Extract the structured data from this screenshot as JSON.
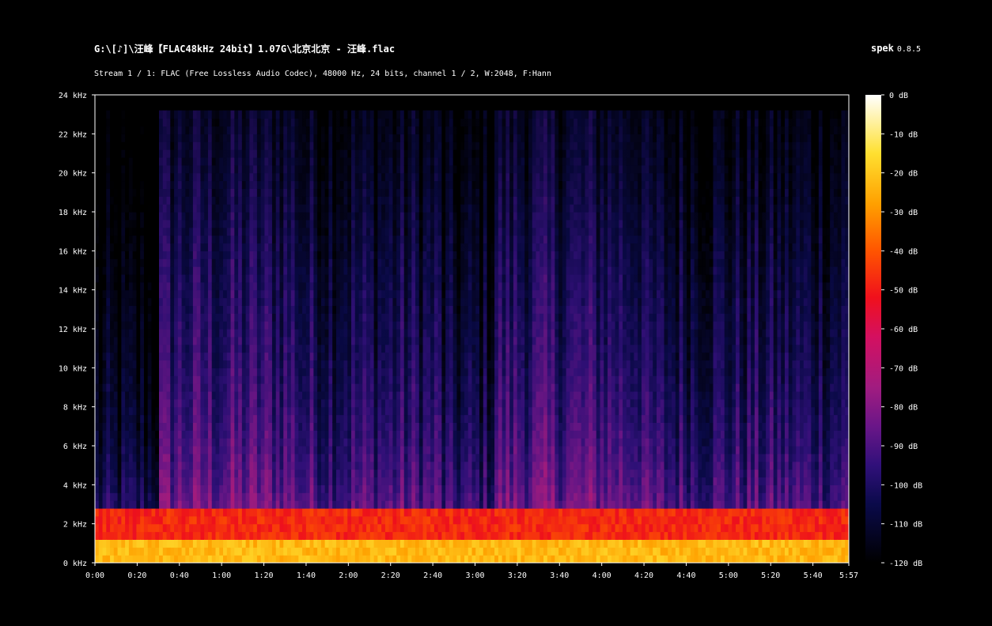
{
  "header": {
    "file_path": "G:\\[♪]\\汪峰【FLAC48kHz 24bit】1.07G\\北京北京 - 汪峰.flac",
    "stream_info": "Stream 1 / 1: FLAC (Free Lossless Audio Codec), 48000 Hz, 24 bits, channel 1 / 2, W:2048, F:Hann",
    "app_name": "spek",
    "app_version": "0.8.5"
  },
  "chart_data": {
    "type": "heatmap",
    "title": "",
    "xlabel": "",
    "ylabel": "",
    "x_unit": "time (m:ss)",
    "y_unit": "kHz",
    "xlim": [
      0,
      357
    ],
    "ylim": [
      0,
      24
    ],
    "x_ticks": [
      {
        "value": 0,
        "label": "0:00"
      },
      {
        "value": 20,
        "label": "0:20"
      },
      {
        "value": 40,
        "label": "0:40"
      },
      {
        "value": 60,
        "label": "1:00"
      },
      {
        "value": 80,
        "label": "1:20"
      },
      {
        "value": 100,
        "label": "1:40"
      },
      {
        "value": 120,
        "label": "2:00"
      },
      {
        "value": 140,
        "label": "2:20"
      },
      {
        "value": 160,
        "label": "2:40"
      },
      {
        "value": 180,
        "label": "3:00"
      },
      {
        "value": 200,
        "label": "3:20"
      },
      {
        "value": 220,
        "label": "3:40"
      },
      {
        "value": 240,
        "label": "4:00"
      },
      {
        "value": 260,
        "label": "4:20"
      },
      {
        "value": 280,
        "label": "4:40"
      },
      {
        "value": 300,
        "label": "5:00"
      },
      {
        "value": 320,
        "label": "5:20"
      },
      {
        "value": 340,
        "label": "5:40"
      },
      {
        "value": 357,
        "label": "5:57"
      }
    ],
    "y_ticks": [
      {
        "value": 0,
        "label": "0 kHz"
      },
      {
        "value": 2,
        "label": "2 kHz"
      },
      {
        "value": 4,
        "label": "4 kHz"
      },
      {
        "value": 6,
        "label": "6 kHz"
      },
      {
        "value": 8,
        "label": "8 kHz"
      },
      {
        "value": 10,
        "label": "10 kHz"
      },
      {
        "value": 12,
        "label": "12 kHz"
      },
      {
        "value": 14,
        "label": "14 kHz"
      },
      {
        "value": 16,
        "label": "16 kHz"
      },
      {
        "value": 18,
        "label": "18 kHz"
      },
      {
        "value": 20,
        "label": "20 kHz"
      },
      {
        "value": 22,
        "label": "22 kHz"
      },
      {
        "value": 24,
        "label": "24 kHz"
      }
    ],
    "colorbar": {
      "range_db": [
        -120,
        0
      ],
      "ticks": [
        {
          "value": 0,
          "label": "0 dB"
        },
        {
          "value": -10,
          "label": "-10 dB"
        },
        {
          "value": -20,
          "label": "-20 dB"
        },
        {
          "value": -30,
          "label": "-30 dB"
        },
        {
          "value": -40,
          "label": "-40 dB"
        },
        {
          "value": -50,
          "label": "-50 dB"
        },
        {
          "value": -60,
          "label": "-60 dB"
        },
        {
          "value": -70,
          "label": "-70 dB"
        },
        {
          "value": -80,
          "label": "-80 dB"
        },
        {
          "value": -90,
          "label": "-90 dB"
        },
        {
          "value": -100,
          "label": "-100 dB"
        },
        {
          "value": -110,
          "label": "-110 dB"
        },
        {
          "value": -120,
          "label": "-120 dB"
        }
      ],
      "stops": [
        {
          "db": -120,
          "color": "#000000"
        },
        {
          "db": -105,
          "color": "#0a0a4a"
        },
        {
          "db": -95,
          "color": "#30107a"
        },
        {
          "db": -85,
          "color": "#6a1688"
        },
        {
          "db": -75,
          "color": "#a11c80"
        },
        {
          "db": -62,
          "color": "#d41060"
        },
        {
          "db": -52,
          "color": "#f0101c"
        },
        {
          "db": -40,
          "color": "#ff5500"
        },
        {
          "db": -28,
          "color": "#ffa000"
        },
        {
          "db": -15,
          "color": "#ffe030"
        },
        {
          "db": 0,
          "color": "#ffffff"
        }
      ]
    },
    "spectral_cutoff_khz": 23.2,
    "segments": [
      {
        "start": 0,
        "end": 31,
        "level_db": -108
      },
      {
        "start": 31,
        "end": 96,
        "level_db": -88
      },
      {
        "start": 96,
        "end": 165,
        "level_db": -93
      },
      {
        "start": 165,
        "end": 189,
        "level_db": -100
      },
      {
        "start": 189,
        "end": 261,
        "level_db": -88
      },
      {
        "start": 261,
        "end": 357,
        "level_db": -95
      }
    ]
  }
}
